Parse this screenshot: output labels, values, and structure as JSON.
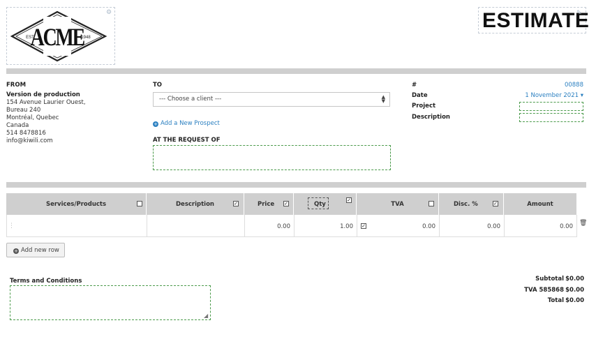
{
  "logo": {
    "wordmark": "ACME",
    "est": "EST",
    "year": "1948"
  },
  "document": {
    "title": "ESTIMATE"
  },
  "from": {
    "label": "FROM",
    "company": "Version de production",
    "address_lines": [
      "154 Avenue Laurier Ouest,",
      "Bureau 240",
      "Montréal, Quebec",
      "Canada",
      "514 8478816",
      "info@kiwili.com"
    ]
  },
  "to": {
    "label": "TO",
    "client_select": "--- Choose a client ---",
    "add_prospect": "Add a New Prospect",
    "request_label": "AT THE REQUEST OF",
    "request_value": ""
  },
  "meta": {
    "number_label": "#",
    "number_value": "00888",
    "date_label": "Date",
    "date_value": "1 November 2021 ▾",
    "project_label": "Project",
    "project_value": "",
    "description_label": "Description",
    "description_value": ""
  },
  "table": {
    "columns": [
      {
        "label": "Services/Products",
        "checked": false
      },
      {
        "label": "Description",
        "checked": true
      },
      {
        "label": "Price",
        "checked": true
      },
      {
        "label": "Qty",
        "checked": true
      },
      {
        "label": "TVA",
        "checked": false
      },
      {
        "label": "Disc. %",
        "checked": true
      },
      {
        "label": "Amount",
        "checked": false
      }
    ],
    "rows": [
      {
        "service": "",
        "description": "",
        "price": "0.00",
        "qty": "1.00",
        "tva_checked": true,
        "tva": "0.00",
        "disc": "0.00",
        "amount": "0.00"
      }
    ],
    "add_row": "Add new row"
  },
  "terms": {
    "label": "Terms and Conditions",
    "value": ""
  },
  "totals": {
    "subtotal_label": "Subtotal",
    "subtotal_value": "$0.00",
    "tva_label": "TVA 585868",
    "tva_value": "$0.00",
    "total_label": "Total",
    "total_value": "$0.00"
  },
  "colors": {
    "accent": "#2a7fc0",
    "dashed_field": "#4a9a4a",
    "header_gray": "#cfcfcf"
  }
}
